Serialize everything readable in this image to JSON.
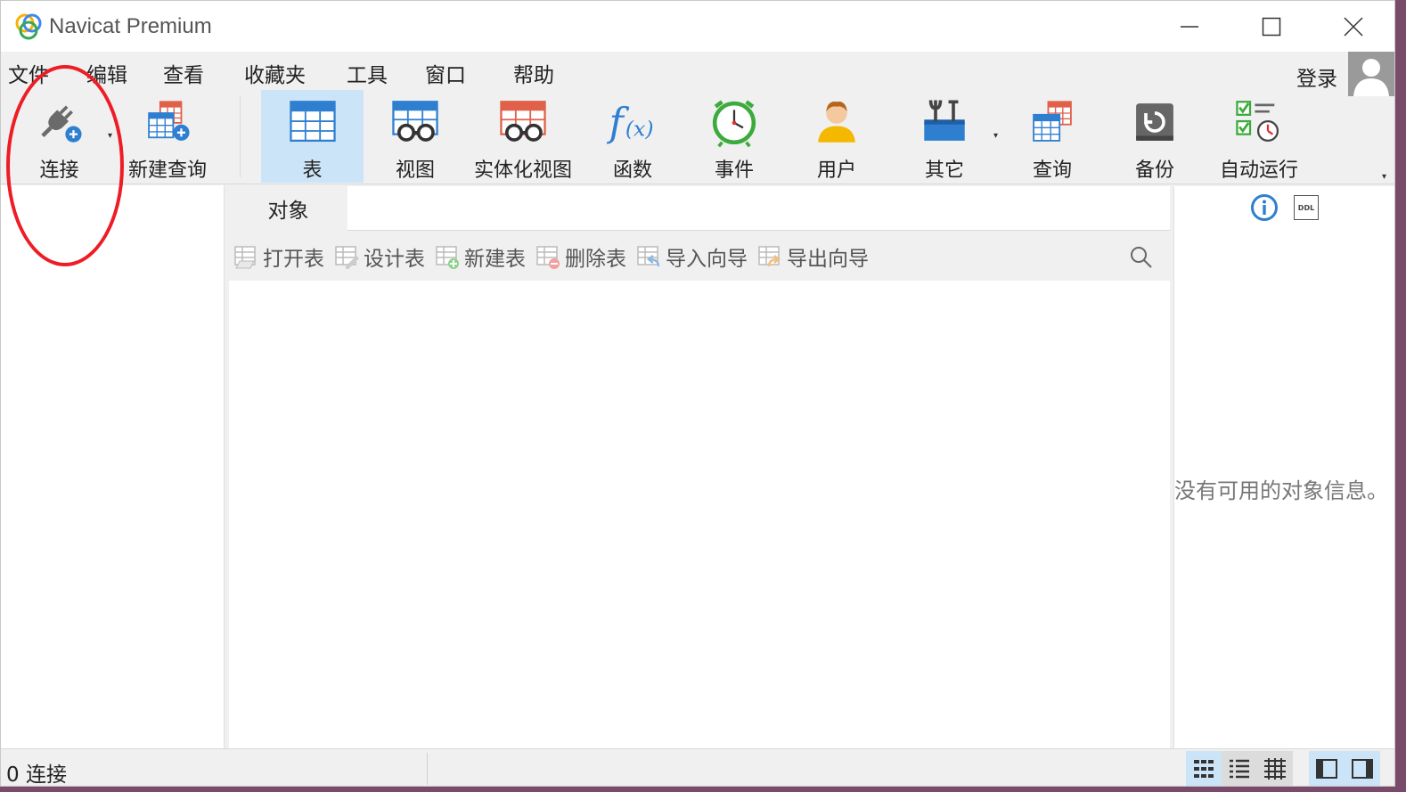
{
  "window": {
    "title": "Navicat Premium"
  },
  "menu": {
    "items": [
      "文件",
      "编辑",
      "查看",
      "收藏夹",
      "工具",
      "窗口",
      "帮助"
    ],
    "login": "登录"
  },
  "toolbar": {
    "connect": "连接",
    "new_query": "新建查询",
    "table": "表",
    "view": "视图",
    "materialized_view": "实体化视图",
    "function": "函数",
    "event": "事件",
    "user": "用户",
    "other": "其它",
    "query": "查询",
    "backup": "备份",
    "automation": "自动运行"
  },
  "tabs": {
    "objects": "对象"
  },
  "object_toolbar": {
    "open_table": "打开表",
    "design_table": "设计表",
    "new_table": "新建表",
    "delete_table": "删除表",
    "import_wizard": "导入向导",
    "export_wizard": "导出向导"
  },
  "info_panel": {
    "ddl_label": "DDL",
    "empty_message": "没有可用的对象信息。"
  },
  "status": {
    "connections": "0 连接"
  },
  "colors": {
    "active_tab": "#cce4f7",
    "annotation": "#ee1c25",
    "accent": "#2f7fd1"
  }
}
